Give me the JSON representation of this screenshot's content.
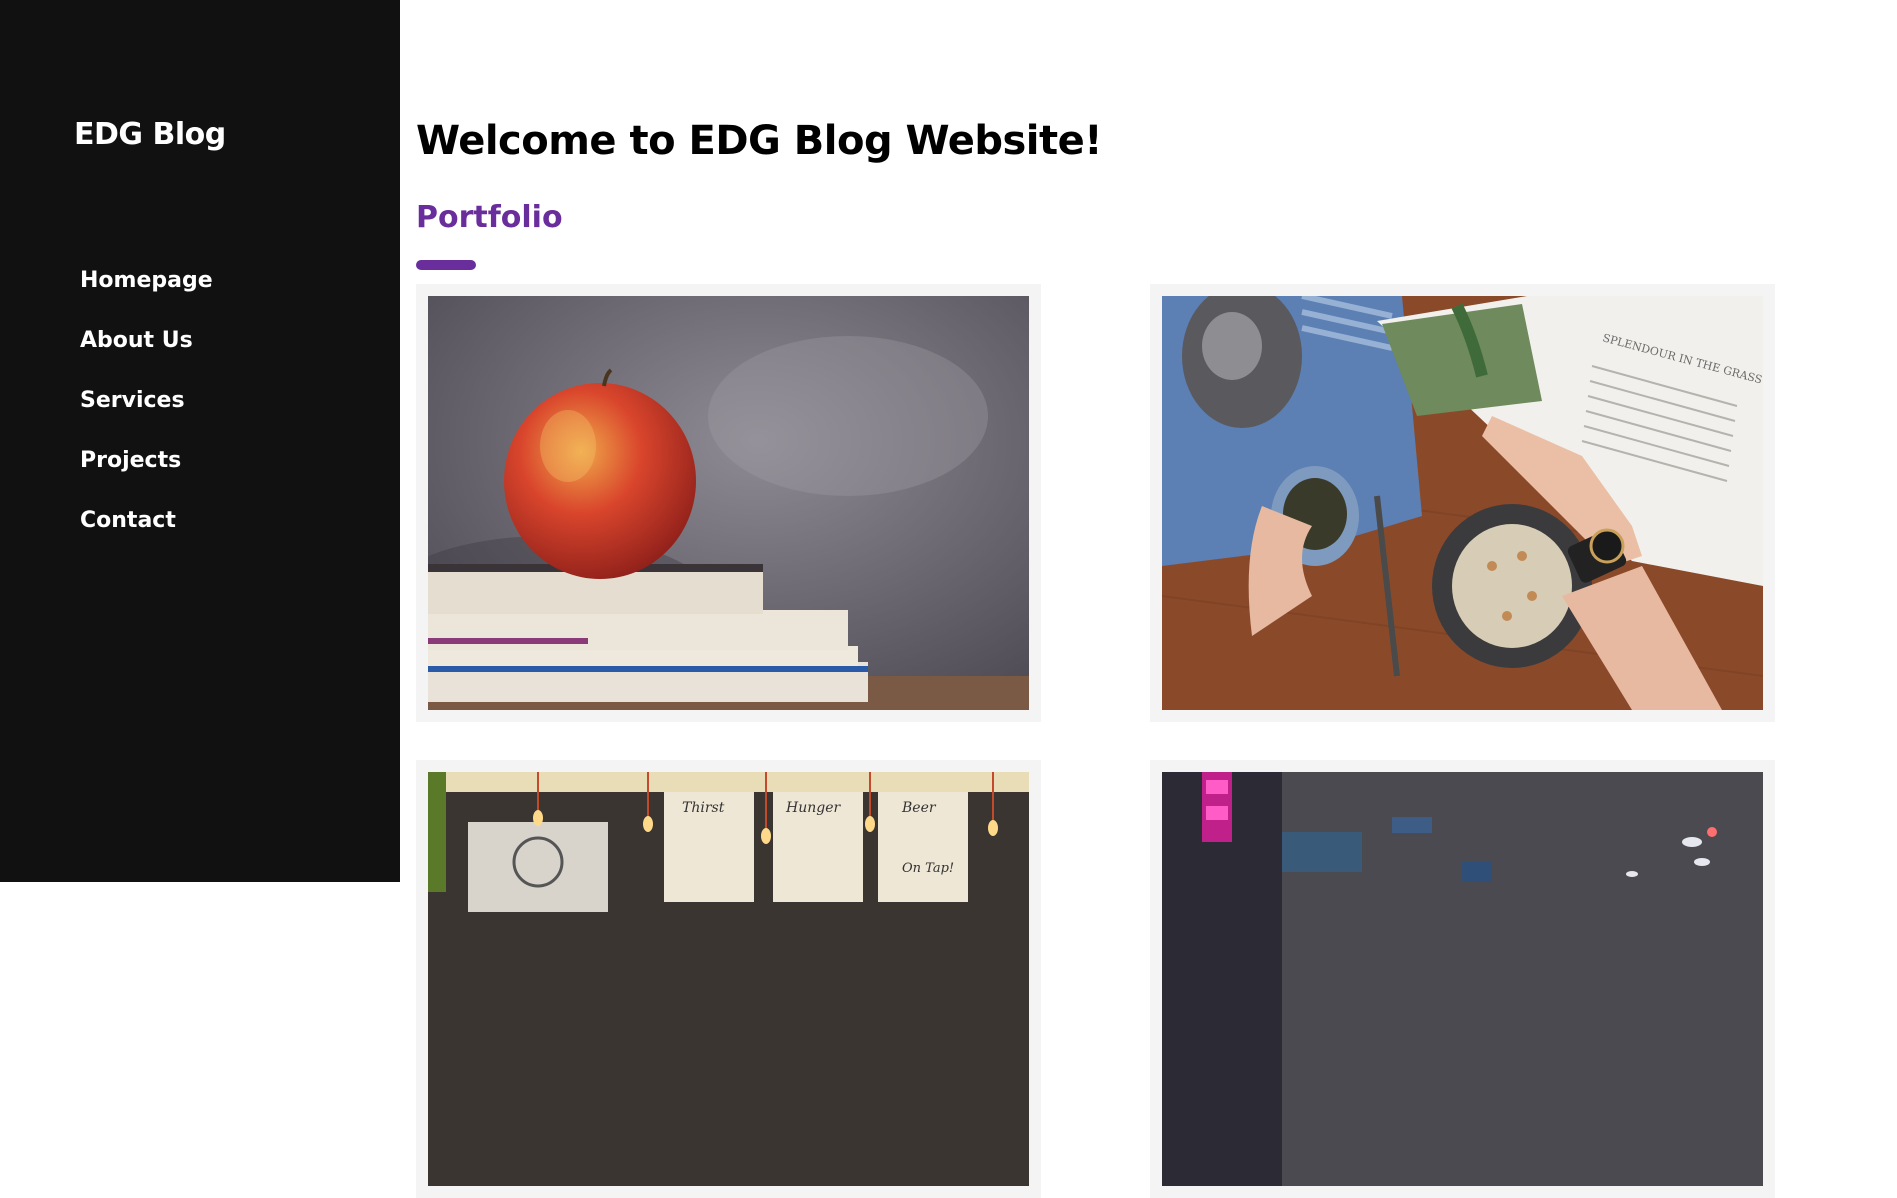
{
  "sidebar": {
    "brand": "EDG Blog",
    "nav": [
      {
        "label": "Homepage"
      },
      {
        "label": "About Us"
      },
      {
        "label": "Services"
      },
      {
        "label": "Projects"
      },
      {
        "label": "Contact"
      }
    ]
  },
  "main": {
    "title": "Welcome to EDG Blog Website!",
    "section_title": "Portfolio",
    "photo_menu": [
      "Thirst",
      "Hunger",
      "Beer",
      "On Tap!"
    ],
    "photo_magazine": "SPLENDOUR IN THE GRASS"
  },
  "colors": {
    "sidebar_bg": "#111111",
    "accent": "#6a2e9c",
    "card_bg": "#f4f4f4"
  }
}
